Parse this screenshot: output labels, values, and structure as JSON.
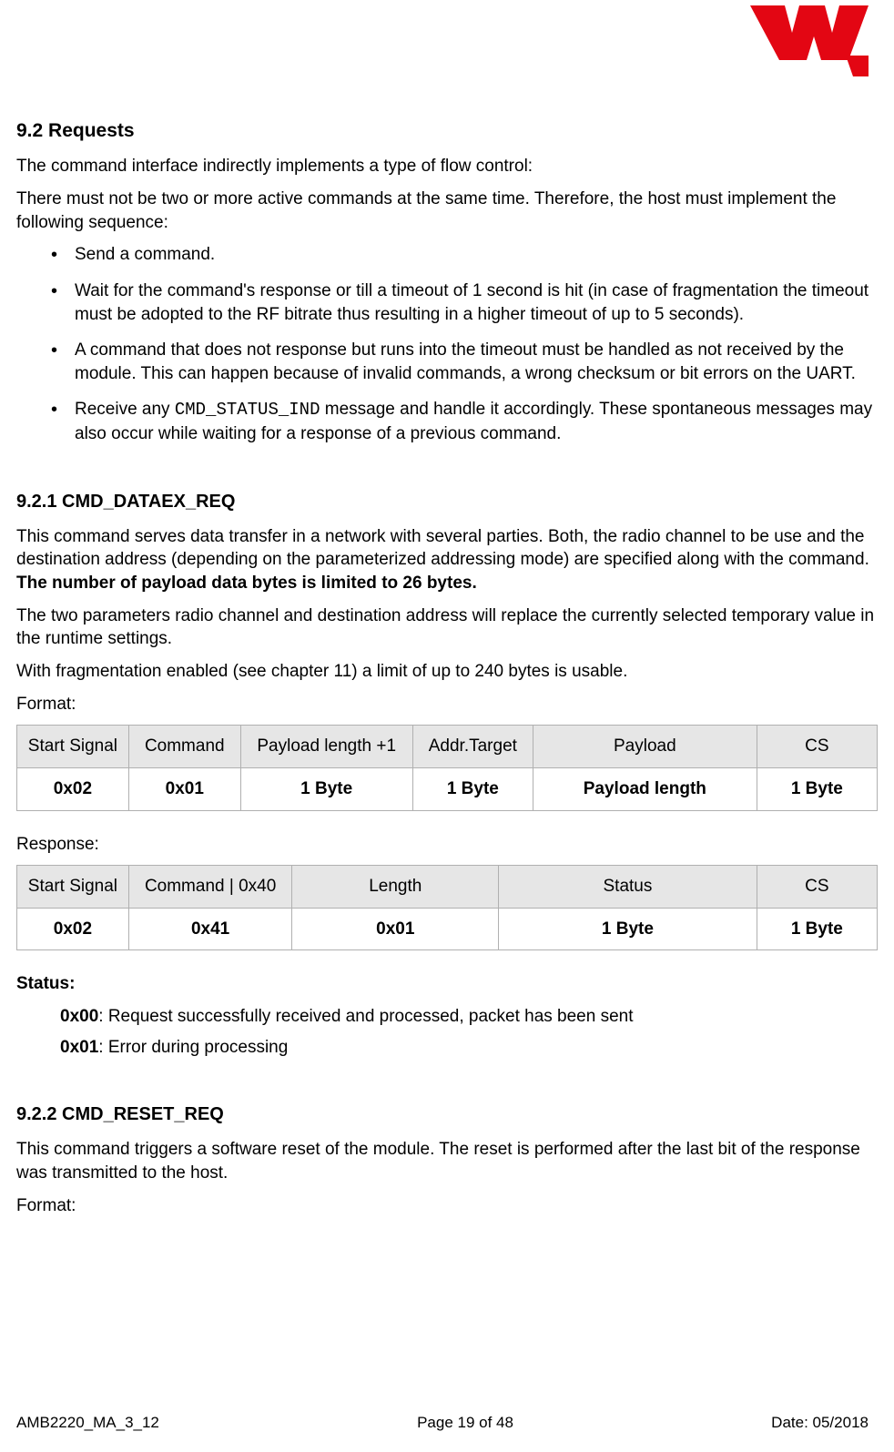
{
  "header": {
    "logo_alt": "WE logo"
  },
  "section": {
    "h2": "9.2 Requests",
    "p1": "The command interface indirectly implements a type of flow control:",
    "p2": "There must not be two or more active commands at the same time. Therefore, the host must implement the following sequence:",
    "bullets": [
      "Send a command.",
      "Wait for the command's response or till a timeout of 1 second is hit (in case of fragmentation the timeout must be adopted to the RF bitrate thus resulting in a higher timeout of up to 5 seconds).",
      "A command that does not response but runs into the timeout must be handled as not received by the module. This can happen because of invalid commands, a wrong checksum or bit errors on the UART."
    ],
    "bullet4_pre": "Receive any ",
    "bullet4_code": "CMD_STATUS_IND",
    "bullet4_post": " message and handle it accordingly. These spontaneous messages may also occur while waiting for a response of a previous command."
  },
  "sub1": {
    "h3": "9.2.1 CMD_DATAEX_REQ",
    "p1_pre": "This command serves data transfer in a network with several parties. Both, the radio channel to be use and the destination address (depending on the parameterized addressing mode) are specified along with the command. ",
    "p1_bold": "The number of payload data bytes is limited to 26 bytes.",
    "p2": "The two parameters radio channel and destination address will replace the currently selected temporary value in the runtime settings.",
    "p3": "With fragmentation enabled (see chapter 11) a limit of up to 240 bytes is usable.",
    "format_label": "Format:",
    "table1": {
      "headers": [
        "Start Signal",
        "Command",
        "Payload length +1",
        "Addr.Target",
        "Payload",
        "CS"
      ],
      "row": [
        "0x02",
        "0x01",
        "1 Byte",
        "1 Byte",
        "Payload length",
        "1 Byte"
      ]
    },
    "response_label": "Response:",
    "table2": {
      "headers": [
        "Start Signal",
        "Command | 0x40",
        "Length",
        "Status",
        "CS"
      ],
      "row": [
        "0x02",
        "0x41",
        "0x01",
        "1 Byte",
        "1 Byte"
      ]
    },
    "status_label": "Status:",
    "status_items": [
      {
        "code": "0x00",
        "text": ": Request successfully received and processed, packet has been sent"
      },
      {
        "code": "0x01",
        "text": ": Error during processing"
      }
    ]
  },
  "sub2": {
    "h3": "9.2.2 CMD_RESET_REQ",
    "p1": "This command triggers a software reset of the module. The reset is performed after the last bit of the response was transmitted to the host.",
    "format_label": "Format:"
  },
  "footer": {
    "left": "AMB2220_MA_3_12",
    "center": "Page 19 of 48",
    "right": "Date: 05/2018"
  }
}
